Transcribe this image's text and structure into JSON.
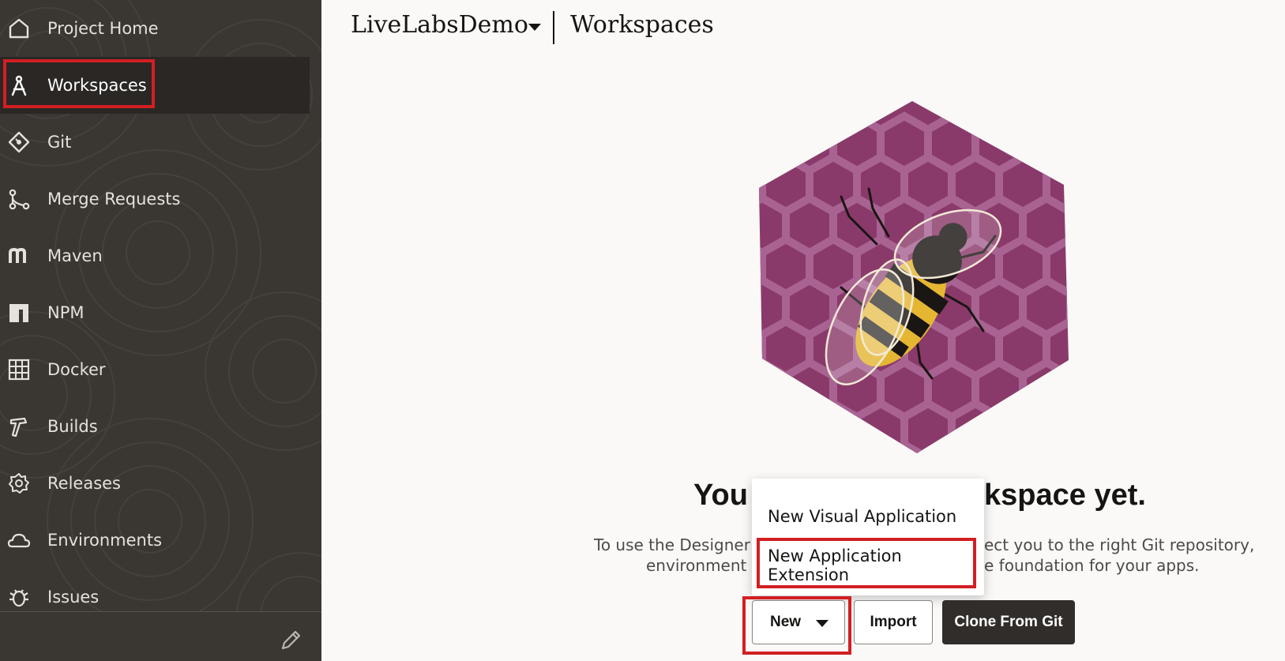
{
  "colors": {
    "sidebar_bg": "#3a3632",
    "highlight_red": "#d21f22",
    "primary_button": "#312d2a",
    "hexagon": "#8a3a6a"
  },
  "sidebar": {
    "items": [
      {
        "label": "Project Home",
        "icon": "home-icon"
      },
      {
        "label": "Workspaces",
        "icon": "compass-icon",
        "active": true
      },
      {
        "label": "Git",
        "icon": "git-icon"
      },
      {
        "label": "Merge Requests",
        "icon": "merge-request-icon"
      },
      {
        "label": "Maven",
        "icon": "maven-icon"
      },
      {
        "label": "NPM",
        "icon": "npm-icon"
      },
      {
        "label": "Docker",
        "icon": "docker-icon"
      },
      {
        "label": "Builds",
        "icon": "hammer-icon"
      },
      {
        "label": "Releases",
        "icon": "gear-badge-icon"
      },
      {
        "label": "Environments",
        "icon": "cloud-icon"
      },
      {
        "label": "Issues",
        "icon": "bug-icon"
      }
    ],
    "footer_icon": "pencil-icon"
  },
  "header": {
    "project": "LiveLabsDemo",
    "page": "Workspaces"
  },
  "empty_state": {
    "title_left": "You",
    "title_right": "kspace yet.",
    "desc_line1_left": "To use the Designer y",
    "desc_line1_right": "ect you to the right Git repository,",
    "desc_line2_left": "environment a",
    "desc_line2_right": "e foundation for your apps."
  },
  "menu": {
    "items": [
      "New Visual Application",
      "New Application Extension"
    ]
  },
  "buttons": {
    "new": "New",
    "import": "Import",
    "clone": "Clone From Git"
  }
}
